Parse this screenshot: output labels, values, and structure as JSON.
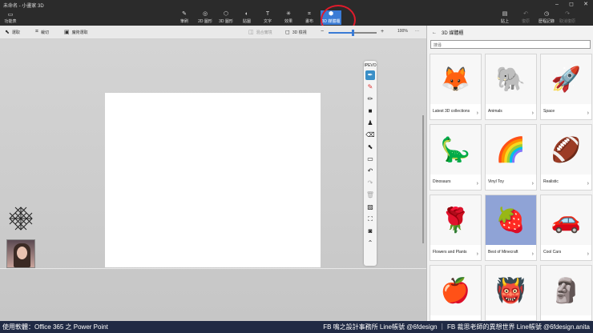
{
  "window": {
    "title": "未命名 - 小畫家 3D",
    "controls": [
      "–",
      "◻",
      "✕"
    ]
  },
  "ribbon": {
    "menu_label": "功能表",
    "tools": [
      {
        "id": "brushes",
        "label": "筆刷",
        "glyph": "✎"
      },
      {
        "id": "2d-shapes",
        "label": "2D 圖形",
        "glyph": "◎"
      },
      {
        "id": "3d-shapes",
        "label": "3D 圖形",
        "glyph": "⬡"
      },
      {
        "id": "stickers",
        "label": "貼圖",
        "glyph": "◐"
      },
      {
        "id": "text",
        "label": "文字",
        "glyph": "T"
      },
      {
        "id": "effects",
        "label": "效果",
        "glyph": "✳"
      },
      {
        "id": "canvas",
        "label": "畫布",
        "glyph": "⌗"
      },
      {
        "id": "3d-library",
        "label": "3D 媒體櫃",
        "glyph": "⬢"
      }
    ],
    "right_tools": [
      {
        "id": "paste",
        "label": "貼上",
        "glyph": "▤"
      },
      {
        "id": "undo",
        "label": "復原",
        "glyph": "↶"
      },
      {
        "id": "history",
        "label": "歷程記錄",
        "glyph": "◷"
      },
      {
        "id": "redo",
        "label": "取消復原",
        "glyph": "↷"
      }
    ]
  },
  "toolbar2": {
    "select": "選取",
    "crop": "裁切",
    "magic_select": "魔術選取",
    "mixed_reality": "混合實境",
    "view_3d": "3D 檢視",
    "zoom_minus": "−",
    "zoom_plus": "+",
    "zoom": "100%",
    "more": "···",
    "progress": 0.5
  },
  "vertical_tools": {
    "header": "IPEVO",
    "items": [
      "pen-icon",
      "marker-icon",
      "pencil-icon",
      "rectangle-icon",
      "stamp-icon",
      "eraser-icon",
      "pointer-icon",
      "whiteboard-icon",
      "undo-icon",
      "redo-icon",
      "trash-icon",
      "screenshot-icon",
      "region-capture-icon",
      "camera-icon",
      "chevron-up-icon"
    ]
  },
  "panel": {
    "title": "3D 媒體櫃",
    "search_placeholder": "搜尋",
    "cards": [
      {
        "label": "Latest 3D collections",
        "glyph": "🦊"
      },
      {
        "label": "Animals",
        "glyph": "🐘"
      },
      {
        "label": "Space",
        "glyph": "🚀"
      },
      {
        "label": "Dinosaurs",
        "glyph": "🦕"
      },
      {
        "label": "Vinyl Toy",
        "glyph": "🌈"
      },
      {
        "label": "Realistic",
        "glyph": "🏈"
      },
      {
        "label": "Flowers and Plants",
        "glyph": "🌹"
      },
      {
        "label": "Best of Minecraft",
        "glyph": "🍓"
      },
      {
        "label": "Cool Cars",
        "glyph": "🚗"
      },
      {
        "label": "",
        "glyph": "🍎"
      },
      {
        "label": "",
        "glyph": "👹"
      },
      {
        "label": "",
        "glyph": "🗿"
      }
    ]
  },
  "footer": {
    "left": "使用軟體：Office 365 之 Power Point",
    "right": "FB 鳴之設計事務所 Line帳號 @6fdesign ｜ FB 裁思老師的異想世界 Line帳號 @6fdesign.anita"
  },
  "colors": {
    "accent": "#3a7bd5",
    "highlight": "#e01b2b",
    "footer_bg": "#202a44"
  }
}
